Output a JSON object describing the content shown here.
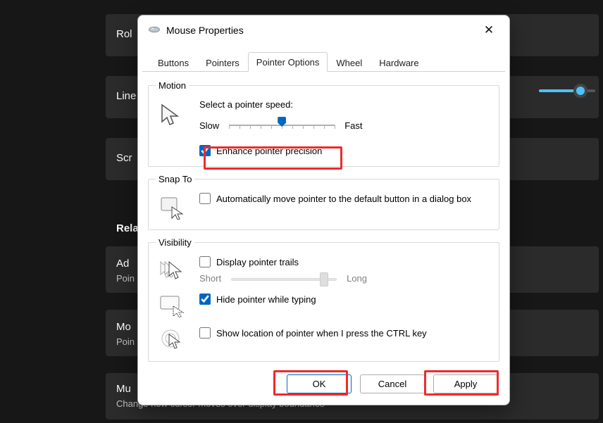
{
  "bg": {
    "heading_related": "Related",
    "item_rol": "Rol",
    "item_line": "Line",
    "item_scr": "Scr",
    "item_ad": "Ad",
    "item_ad_sub": "Poin",
    "item_mo": "Mo",
    "item_mo_sub": "Poin",
    "item_mu": "Mu",
    "item_mu_sub": "Change how cursor moves over display boundaries"
  },
  "dialog": {
    "title": "Mouse Properties",
    "close_glyph": "✕",
    "tabs": {
      "buttons": "Buttons",
      "pointers": "Pointers",
      "pointer_options": "Pointer Options",
      "wheel": "Wheel",
      "hardware": "Hardware"
    },
    "motion": {
      "legend": "Motion",
      "speed_label": "Select a pointer speed:",
      "slow": "Slow",
      "fast": "Fast",
      "enhance_label": "Enhance pointer precision",
      "enhance_checked": true
    },
    "snapto": {
      "legend": "Snap To",
      "auto_label": "Automatically move pointer to the default button in a dialog box",
      "auto_checked": false
    },
    "visibility": {
      "legend": "Visibility",
      "trails_label": "Display pointer trails",
      "trails_checked": false,
      "short": "Short",
      "long": "Long",
      "hide_label": "Hide pointer while typing",
      "hide_checked": true,
      "ctrl_label": "Show location of pointer when I press the CTRL key",
      "ctrl_checked": false
    },
    "buttons": {
      "ok": "OK",
      "cancel": "Cancel",
      "apply": "Apply"
    }
  }
}
